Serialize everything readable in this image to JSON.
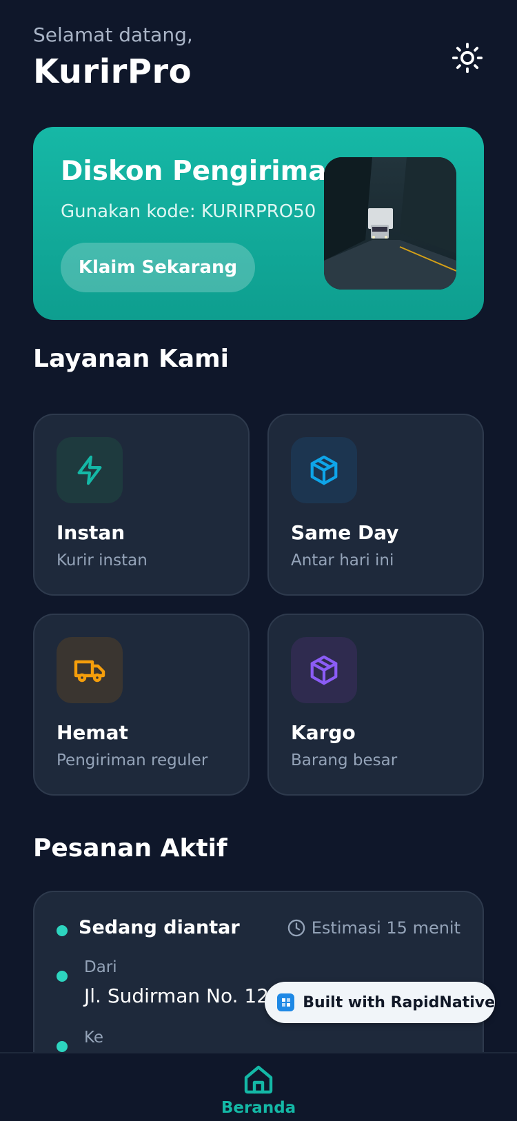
{
  "header": {
    "greeting": "Selamat datang,",
    "app_name": "KurirPro",
    "theme_icon": "sun-icon"
  },
  "promo": {
    "title": "Diskon Pengiriman",
    "code_text": "Gunakan kode: KURIRPRO50",
    "button_label": "Klaim Sekarang",
    "image": "truck-on-mountain-road-photo"
  },
  "services": {
    "title": "Layanan Kami",
    "items": [
      {
        "name": "Instan",
        "desc": "Kurir instan",
        "icon": "lightning-icon",
        "color": "#14B8A6"
      },
      {
        "name": "Same Day",
        "desc": "Antar hari ini",
        "icon": "package-icon",
        "color": "#0EA5E9"
      },
      {
        "name": "Hemat",
        "desc": "Pengiriman reguler",
        "icon": "truck-icon",
        "color": "#F59E0B"
      },
      {
        "name": "Kargo",
        "desc": "Barang besar",
        "icon": "box-icon",
        "color": "#8B5CF6"
      }
    ]
  },
  "active_orders": {
    "title": "Pesanan Aktif",
    "status": "Sedang diantar",
    "eta": "Estimasi 15 menit",
    "from_label": "Dari",
    "from_address": "Jl. Sudirman No. 123",
    "to_label": "Ke"
  },
  "badge": {
    "text": "Built with RapidNative"
  },
  "nav": {
    "home_label": "Beranda"
  },
  "colors": {
    "accent": "#14B8A6",
    "background": "#0F172A",
    "card": "#1E293B"
  }
}
